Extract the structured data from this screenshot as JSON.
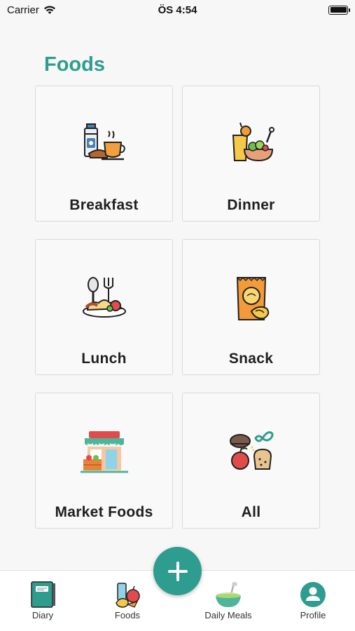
{
  "status_bar": {
    "carrier": "Carrier",
    "time": "ÖS 4:54"
  },
  "page": {
    "title": "Foods"
  },
  "categories": [
    {
      "label": "Breakfast",
      "icon": "breakfast-icon"
    },
    {
      "label": "Dinner",
      "icon": "dinner-icon"
    },
    {
      "label": "Lunch",
      "icon": "lunch-icon"
    },
    {
      "label": "Snack",
      "icon": "snack-icon"
    },
    {
      "label": "Market Foods",
      "icon": "market-icon"
    },
    {
      "label": "All",
      "icon": "all-foods-icon"
    }
  ],
  "fab": {
    "icon": "plus-icon"
  },
  "tabs": [
    {
      "label": "Diary",
      "icon": "diary-icon"
    },
    {
      "label": "Foods",
      "icon": "foods-icon"
    },
    {
      "label": "Daily Meals",
      "icon": "bowl-icon"
    },
    {
      "label": "Profile",
      "icon": "profile-icon"
    }
  ],
  "colors": {
    "accent": "#2e9c8e",
    "background": "#f7f7f7",
    "card_border": "#d9d9d9"
  }
}
